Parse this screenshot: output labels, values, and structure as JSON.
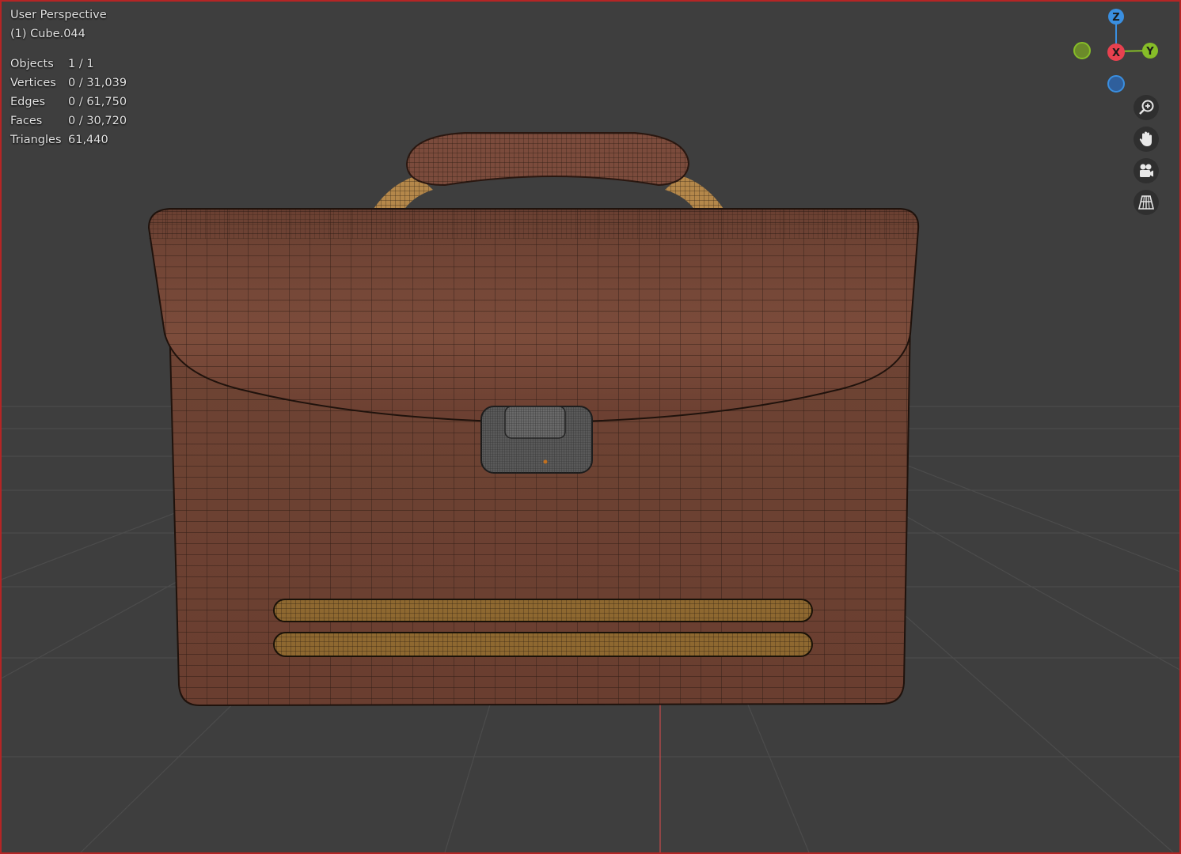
{
  "viewport": {
    "view_name": "User Perspective",
    "object_name": "(1) Cube.044",
    "stats": [
      {
        "label": "Objects",
        "value": "1 / 1"
      },
      {
        "label": "Vertices",
        "value": "0 / 31,039"
      },
      {
        "label": "Edges",
        "value": "0 / 61,750"
      },
      {
        "label": "Faces",
        "value": "0 / 30,720"
      },
      {
        "label": "Triangles",
        "value": "61,440"
      }
    ]
  },
  "gizmo": {
    "z_label": "Z",
    "y_label": "Y",
    "x_label": "X",
    "colors": {
      "x": "#e8414f",
      "y": "#86bd28",
      "z": "#3a8fe0",
      "neg_y": "#6b8a2a",
      "neg_z": "#2f5f9c"
    }
  },
  "nav_buttons": [
    {
      "name": "zoom-icon"
    },
    {
      "name": "hand-pan-icon"
    },
    {
      "name": "camera-icon"
    },
    {
      "name": "grid-perspective-icon"
    }
  ],
  "colors": {
    "viewport_border": "#b52525",
    "background": "#3e3e3e",
    "grid_line": "#4e4e4e",
    "leather": "#7a4a3a",
    "leather_dark": "#5a3428",
    "strap": "#9a7032",
    "handle_bracket": "#b58a4c",
    "lock": "#5c5c5c"
  }
}
